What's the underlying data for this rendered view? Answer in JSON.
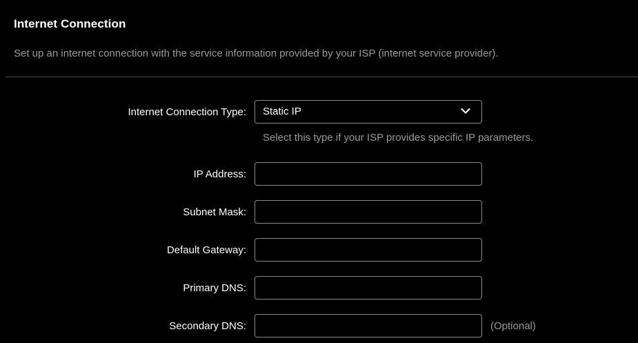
{
  "section": {
    "title": "Internet Connection",
    "description": "Set up an internet connection with the service information provided by your ISP (internet service provider)."
  },
  "connection_type": {
    "label": "Internet Connection Type:",
    "selected": "Static IP",
    "hint": "Select this type if your ISP provides specific IP parameters."
  },
  "fields": {
    "ip_address": {
      "label": "IP Address:",
      "value": ""
    },
    "subnet_mask": {
      "label": "Subnet Mask:",
      "value": ""
    },
    "default_gateway": {
      "label": "Default Gateway:",
      "value": ""
    },
    "primary_dns": {
      "label": "Primary DNS:",
      "value": ""
    },
    "secondary_dns": {
      "label": "Secondary DNS:",
      "value": "",
      "note": "(Optional)"
    }
  },
  "colors": {
    "background": "#000000",
    "text": "#ffffff",
    "muted_text": "#9a9a9a",
    "input_border": "#8a8a8a",
    "divider": "#4a4a4a"
  }
}
